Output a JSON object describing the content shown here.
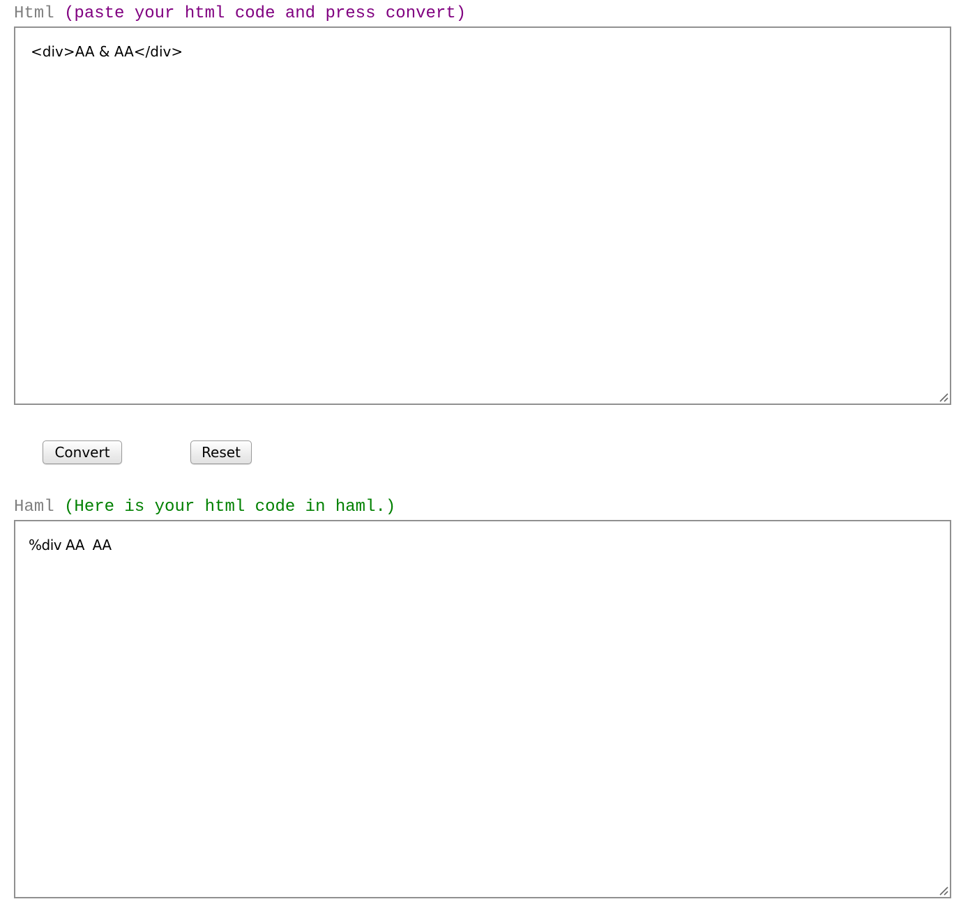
{
  "html_section": {
    "label": "Html",
    "hint": "(paste your html code and press convert)",
    "hint_color": "#800080",
    "input_value": "<div>AA & AA</div>"
  },
  "buttons": {
    "convert_label": "Convert",
    "reset_label": "Reset"
  },
  "haml_section": {
    "label": "Haml",
    "hint": "(Here is your html code in haml.)",
    "hint_color": "#008000",
    "output_value": "%div AA  AA"
  },
  "icons": {
    "resize_grip": "resize-grip-icon"
  }
}
